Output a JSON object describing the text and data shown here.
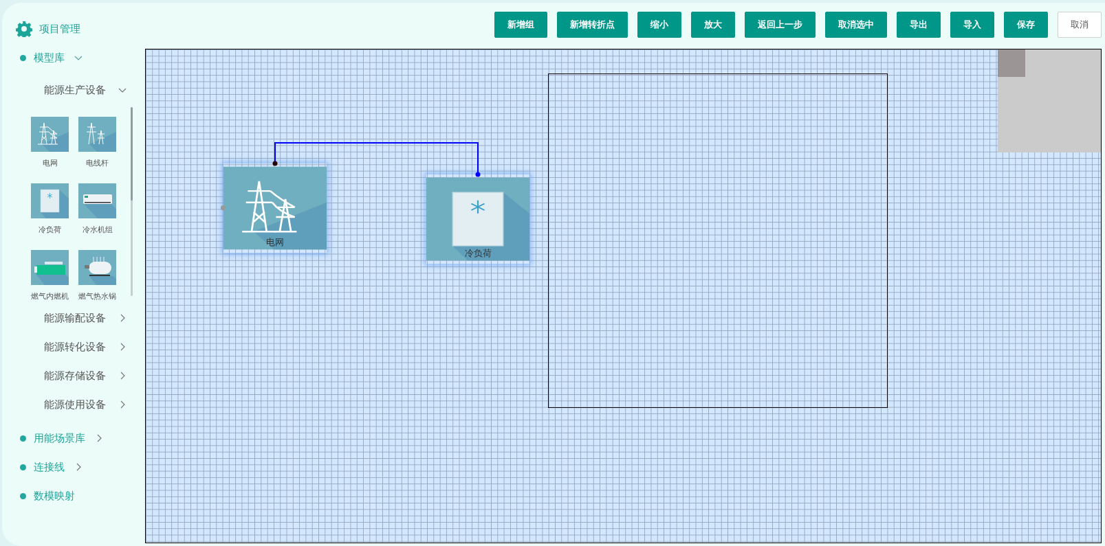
{
  "header": {
    "title": "项目管理"
  },
  "toolbar": {
    "buttons": [
      {
        "label": "新增组",
        "kind": "primary"
      },
      {
        "label": "新增转折点",
        "kind": "primary"
      },
      {
        "label": "缩小",
        "kind": "primary"
      },
      {
        "label": "放大",
        "kind": "primary"
      },
      {
        "label": "返回上一步",
        "kind": "primary"
      },
      {
        "label": "取消选中",
        "kind": "primary"
      },
      {
        "label": "导出",
        "kind": "primary"
      },
      {
        "label": "导入",
        "kind": "primary"
      },
      {
        "label": "保存",
        "kind": "primary"
      },
      {
        "label": "取消",
        "kind": "plain"
      }
    ]
  },
  "sidebar": {
    "sections": [
      {
        "label": "模型库",
        "kind": "folder",
        "expanded": true,
        "children": [
          {
            "label": "能源生产设备",
            "expanded": true,
            "items": [
              {
                "label": "电网",
                "kind": "grid"
              },
              {
                "label": "电线杆",
                "kind": "pole"
              },
              {
                "label": "冷负荷",
                "kind": "load"
              },
              {
                "label": "冷水机组",
                "kind": "chiller"
              },
              {
                "label": "燃气内燃机",
                "kind": "engine"
              },
              {
                "label": "燃气热水锅",
                "kind": "boiler"
              }
            ]
          },
          {
            "label": "能源输配设备",
            "expanded": false
          },
          {
            "label": "能源转化设备",
            "expanded": false
          },
          {
            "label": "能源存储设备",
            "expanded": false
          },
          {
            "label": "能源使用设备",
            "expanded": false
          }
        ]
      },
      {
        "label": "用能场景库",
        "kind": "folder",
        "expanded": false
      },
      {
        "label": "连接线",
        "kind": "folder",
        "expanded": false
      },
      {
        "label": "数模映射",
        "kind": "leaf"
      }
    ]
  },
  "canvas": {
    "nodes": [
      {
        "label": "电网",
        "kind": "grid"
      },
      {
        "label": "冷负荷",
        "kind": "load"
      }
    ]
  }
}
